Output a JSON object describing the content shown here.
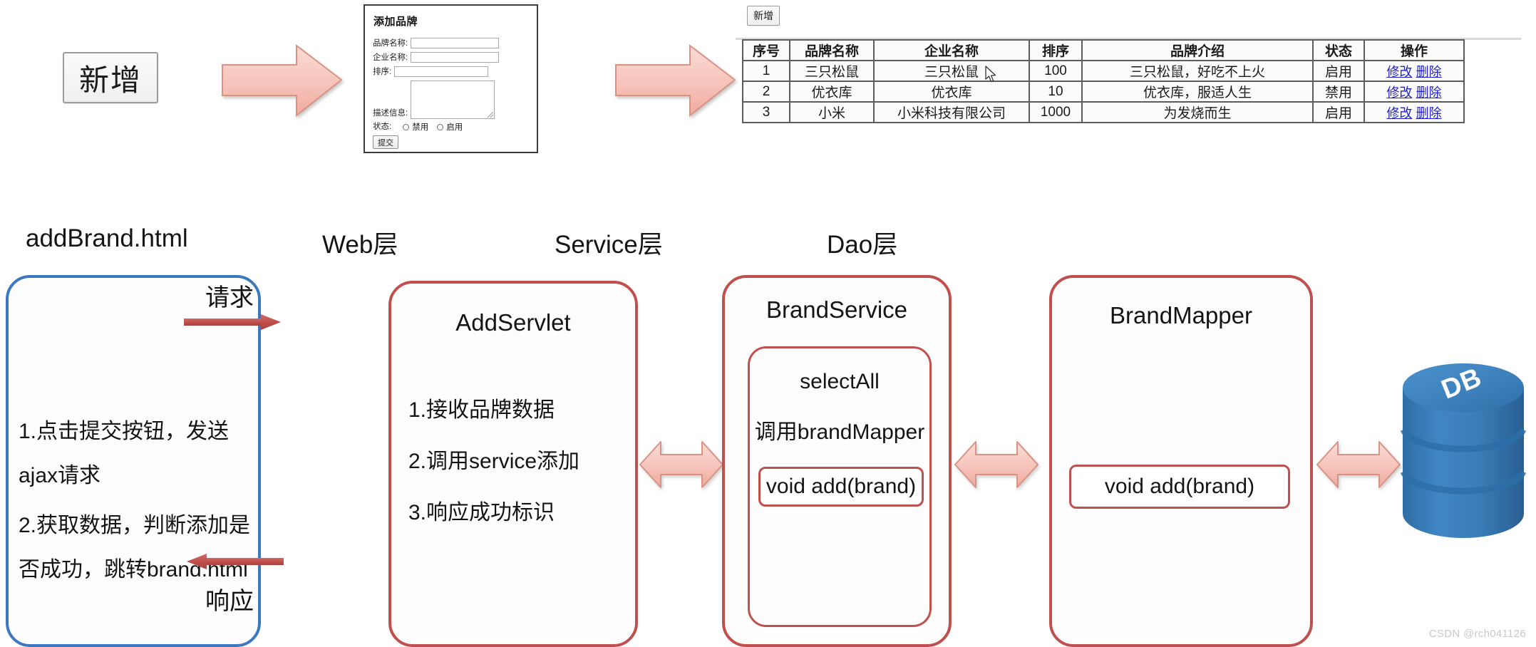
{
  "top_flow": {
    "new_button_label": "新增",
    "arrow1_icon": "right-block-arrow-icon",
    "arrow2_icon": "right-block-arrow-icon"
  },
  "add_brand_form": {
    "title": "添加品牌",
    "fields": [
      {
        "label": "品牌名称:",
        "value": "",
        "placeholder": ""
      },
      {
        "label": "企业名称:",
        "value": "",
        "placeholder": ""
      },
      {
        "label": "排序:",
        "value": "",
        "placeholder": ""
      },
      {
        "label": "描述信息:",
        "value": "",
        "placeholder": ""
      }
    ],
    "status_label": "状态:",
    "status_options": [
      "禁用",
      "启用"
    ],
    "submit_label": "提交"
  },
  "brand_table_panel": {
    "new_button_label": "新增",
    "columns": [
      "序号",
      "品牌名称",
      "企业名称",
      "排序",
      "品牌介绍",
      "状态",
      "操作"
    ],
    "rows": [
      {
        "index": "1",
        "brand_name": "三只松鼠",
        "company_name": "三只松鼠",
        "ordernum": "100",
        "description": "三只松鼠，好吃不上火",
        "status": "启用",
        "edit": "修改",
        "delete": "删除"
      },
      {
        "index": "2",
        "brand_name": "优衣库",
        "company_name": "优衣库",
        "ordernum": "10",
        "description": "优衣库，服适人生",
        "status": "禁用",
        "edit": "修改",
        "delete": "删除"
      },
      {
        "index": "3",
        "brand_name": "小米",
        "company_name": "小米科技有限公司",
        "ordernum": "1000",
        "description": "为发烧而生",
        "status": "启用",
        "edit": "修改",
        "delete": "删除"
      }
    ]
  },
  "layer_captions": [
    "addBrand.html",
    "Web层",
    "Service层",
    "Dao层"
  ],
  "client_box": {
    "lines": [
      "1.点击提交按钮，发送",
      "ajax请求",
      "2.获取数据，判断添加是",
      "否成功，跳转brand.html"
    ]
  },
  "servlet_box": {
    "title": "AddServlet",
    "lines": [
      "1.接收品牌数据",
      "2.调用service添加",
      "3.响应成功标识"
    ]
  },
  "service_box": {
    "title": "BrandService",
    "inner_title": "selectAll",
    "inner_line": "调用brandMapper",
    "method": "void add(brand)"
  },
  "mapper_box": {
    "title": "BrandMapper",
    "method": "void add(brand)"
  },
  "database": {
    "label": "DB"
  },
  "connectors": {
    "request_label": "请求",
    "response_label": "响应",
    "bidirectional_icon": "double-arrow-icon"
  },
  "watermark": "CSDN @rch041126",
  "colors": {
    "red_border": "#c0504d",
    "blue_border": "#3c78bf",
    "pink_arrow_fill": "#f6c6bf",
    "link_blue": "#2222cc",
    "db_blue": "#2e6da4"
  }
}
